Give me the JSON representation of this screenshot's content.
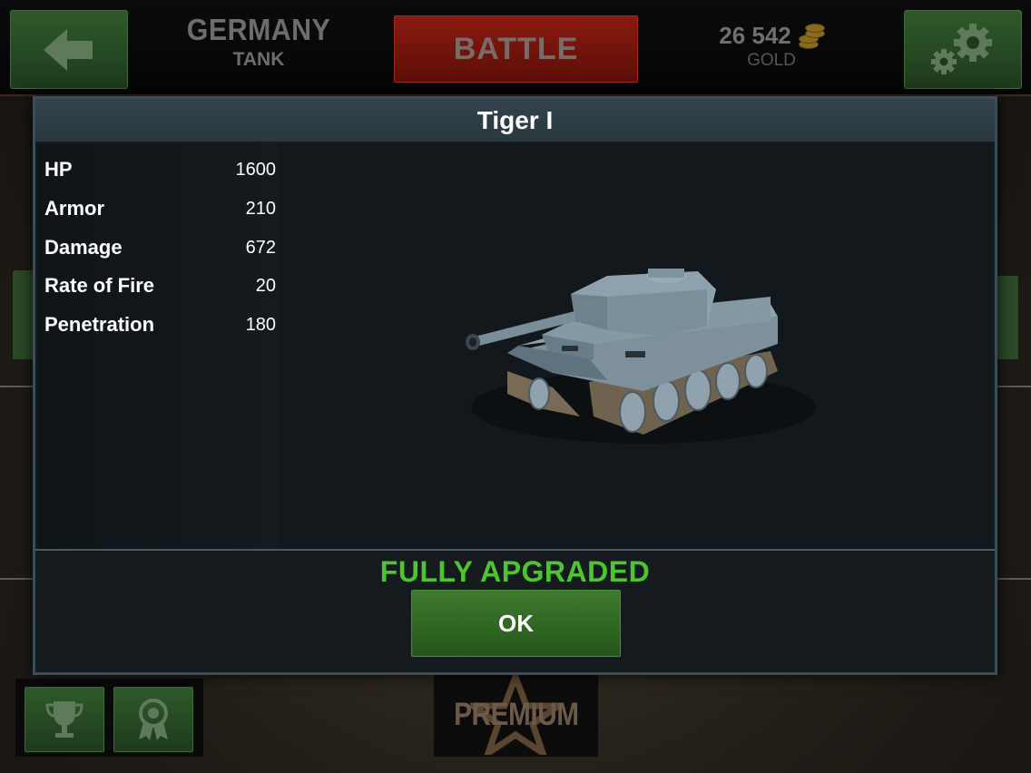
{
  "header": {
    "country": "GERMANY",
    "category": "TANK",
    "battle_label": "BATTLE",
    "gold_amount": "26 542",
    "gold_label": "GOLD"
  },
  "bottom": {
    "premium_label": "PREMIUM"
  },
  "dialog": {
    "title": "Tiger I",
    "stats": [
      {
        "label": "HP",
        "value": "1600"
      },
      {
        "label": "Armor",
        "value": "210"
      },
      {
        "label": "Damage",
        "value": "672"
      },
      {
        "label": "Rate of Fire",
        "value": "20"
      },
      {
        "label": "Penetration",
        "value": "180"
      }
    ],
    "status": "FULLY APGRADED",
    "ok_label": "OK"
  },
  "icons": {
    "back": "arrow-left-icon",
    "settings": "gears-icon",
    "gold": "coin-stack-icon",
    "trophy": "trophy-icon",
    "medal": "medal-icon",
    "premium_star": "star-icon"
  },
  "colors": {
    "accent_green": "#4cc52f",
    "button_green": "#2f5a2b",
    "battle_red": "#8a1a10",
    "dialog_border": "#3d4d57"
  }
}
